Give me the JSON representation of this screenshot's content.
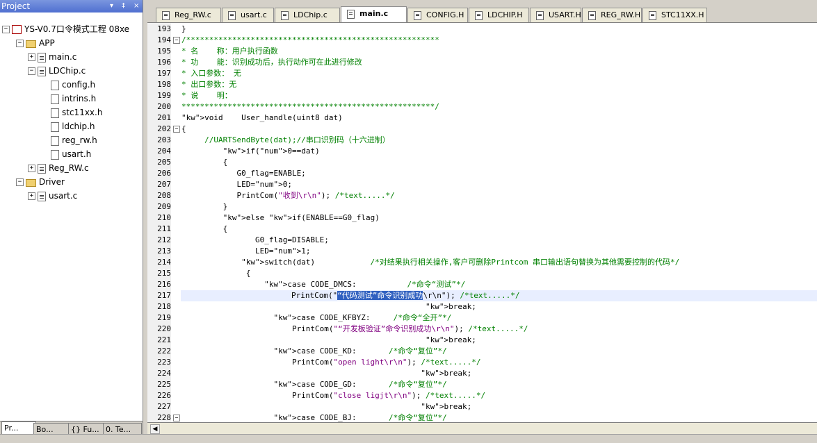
{
  "project_panel": {
    "title": "Project",
    "pin": "▾",
    "pin2": "‡",
    "close": "×",
    "root": "YS-V0.7口令模式工程 08xe",
    "tree": [
      {
        "label": "APP",
        "type": "folder",
        "expander": "−"
      },
      {
        "label": "main.c",
        "type": "file",
        "expander": "+"
      },
      {
        "label": "LDChip.c",
        "type": "file",
        "expander": "−"
      },
      {
        "label": "config.h",
        "type": "header"
      },
      {
        "label": "intrins.h",
        "type": "header"
      },
      {
        "label": "stc11xx.h",
        "type": "header"
      },
      {
        "label": "ldchip.h",
        "type": "header"
      },
      {
        "label": "reg_rw.h",
        "type": "header"
      },
      {
        "label": "usart.h",
        "type": "header"
      },
      {
        "label": "Reg_RW.c",
        "type": "file",
        "expander": "+"
      },
      {
        "label": "Driver",
        "type": "folder",
        "expander": "−"
      },
      {
        "label": "usart.c",
        "type": "file",
        "expander": "+"
      }
    ],
    "bottom_tabs": [
      "Pr...",
      "Bo...",
      "{} Fu...",
      "0. Te..."
    ]
  },
  "editor_tabs": [
    {
      "label": "Reg_RW.c",
      "active": false
    },
    {
      "label": "usart.c",
      "active": false
    },
    {
      "label": "LDChip.c",
      "active": false
    },
    {
      "label": "main.c",
      "active": true
    },
    {
      "label": "CONFIG.H",
      "active": false
    },
    {
      "label": "LDCHIP.H",
      "active": false
    },
    {
      "label": "USART.H",
      "active": false
    },
    {
      "label": "REG_RW.H",
      "active": false
    },
    {
      "label": "STC11XX.H",
      "active": false
    }
  ],
  "code_lines": [
    {
      "n": "193",
      "fold": "",
      "text": "}"
    },
    {
      "n": "194",
      "fold": "−",
      "text": "/*******************************************************"
    },
    {
      "n": "195",
      "fold": "",
      "text": "* 名    称：用户执行函数"
    },
    {
      "n": "196",
      "fold": "",
      "text": "* 功    能：识别成功后，执行动作可在此进行修改"
    },
    {
      "n": "197",
      "fold": "",
      "text": "* 入口参数： 无"
    },
    {
      "n": "198",
      "fold": "",
      "text": "* 出口参数：无"
    },
    {
      "n": "199",
      "fold": "",
      "text": "* 说    明："
    },
    {
      "n": "200",
      "fold": "",
      "text": "*******************************************************/"
    },
    {
      "n": "201",
      "fold": "",
      "text": "void    User_handle(uint8 dat)"
    },
    {
      "n": "202",
      "fold": "−",
      "text": "{"
    },
    {
      "n": "203",
      "fold": "",
      "text": "     //UARTSendByte(dat);//串口识别码（十六进制）"
    },
    {
      "n": "204",
      "fold": "",
      "text": "         if(0==dat)"
    },
    {
      "n": "205",
      "fold": "",
      "text": "         {"
    },
    {
      "n": "206",
      "fold": "",
      "text": "            G0_flag=ENABLE;"
    },
    {
      "n": "207",
      "fold": "",
      "text": "            LED=0;"
    },
    {
      "n": "208",
      "fold": "",
      "text": "            PrintCom(\"收到\\r\\n\"); /*text.....*/"
    },
    {
      "n": "209",
      "fold": "",
      "text": "         }"
    },
    {
      "n": "210",
      "fold": "",
      "text": "         else if(ENABLE==G0_flag)"
    },
    {
      "n": "211",
      "fold": "",
      "text": "         {"
    },
    {
      "n": "212",
      "fold": "",
      "text": "                G0_flag=DISABLE;"
    },
    {
      "n": "213",
      "fold": "",
      "text": "                LED=1;"
    },
    {
      "n": "214",
      "fold": "",
      "text": "             switch(dat)            /*对结果执行相关操作,客户可删除Printcom 串口输出语句替换为其他需要控制的代码*/"
    },
    {
      "n": "215",
      "fold": "",
      "text": "              {"
    },
    {
      "n": "216",
      "fold": "",
      "text": "                  case CODE_DMCS:           /*命令“测试”*/"
    },
    {
      "n": "217",
      "fold": "",
      "text": "                        PrintCom(\"“代码测试”命令识别成功\\r\\n\"); /*text.....*/"
    },
    {
      "n": "218",
      "fold": "",
      "text": "                                                     break;"
    },
    {
      "n": "219",
      "fold": "",
      "text": "                    case CODE_KFBYZ:     /*命令“全开”*/"
    },
    {
      "n": "220",
      "fold": "",
      "text": "                        PrintCom(\"“开发板验证”命令识别成功\\r\\n\"); /*text.....*/"
    },
    {
      "n": "221",
      "fold": "",
      "text": "                                                     break;"
    },
    {
      "n": "222",
      "fold": "",
      "text": "                    case CODE_KD:       /*命令“复位”*/"
    },
    {
      "n": "223",
      "fold": "",
      "text": "                        PrintCom(\"open light\\r\\n\"); /*text.....*/"
    },
    {
      "n": "224",
      "fold": "",
      "text": "                                                    break;"
    },
    {
      "n": "225",
      "fold": "",
      "text": "                    case CODE_GD:       /*命令“复位”*/"
    },
    {
      "n": "226",
      "fold": "",
      "text": "                        PrintCom(\"close ligjt\\r\\n\"); /*text.....*/"
    },
    {
      "n": "227",
      "fold": "",
      "text": "                                                    break;"
    },
    {
      "n": "228",
      "fold": "−",
      "text": "                    case CODE_BJ:       /*命令“复位”*/"
    }
  ],
  "highlight": {
    "line": "217",
    "selected_text": "“代码测试”命令识别成功"
  },
  "scroll_arrow": "◀"
}
